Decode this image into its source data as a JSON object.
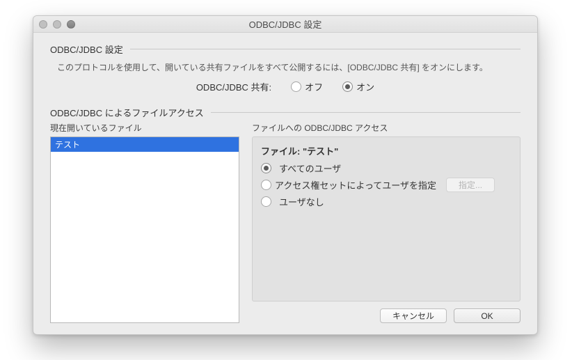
{
  "window": {
    "title": "ODBC/JDBC 設定"
  },
  "section1": {
    "heading": "ODBC/JDBC 設定",
    "description": "このプロトコルを使用して、開いている共有ファイルをすべて公開するには、[ODBC/JDBC 共有] をオンにします。",
    "share_label": "ODBC/JDBC 共有:",
    "off_label": "オフ",
    "on_label": "オン",
    "selected": "on"
  },
  "section2": {
    "heading": "ODBC/JDBC によるファイルアクセス",
    "open_files_label": "現在開いているファイル",
    "files": [
      "テスト"
    ],
    "selected_file_index": 0
  },
  "access": {
    "panel_label": "ファイルへの ODBC/JDBC アクセス",
    "file_prefix": "ファイル: ",
    "file_name": "\"テスト\"",
    "opt_all": "すべてのユーザ",
    "opt_priv": "アクセス権セットによってユーザを指定",
    "opt_none": "ユーザなし",
    "selected": "all",
    "specify_button": "指定..."
  },
  "buttons": {
    "cancel": "キャンセル",
    "ok": "OK"
  }
}
